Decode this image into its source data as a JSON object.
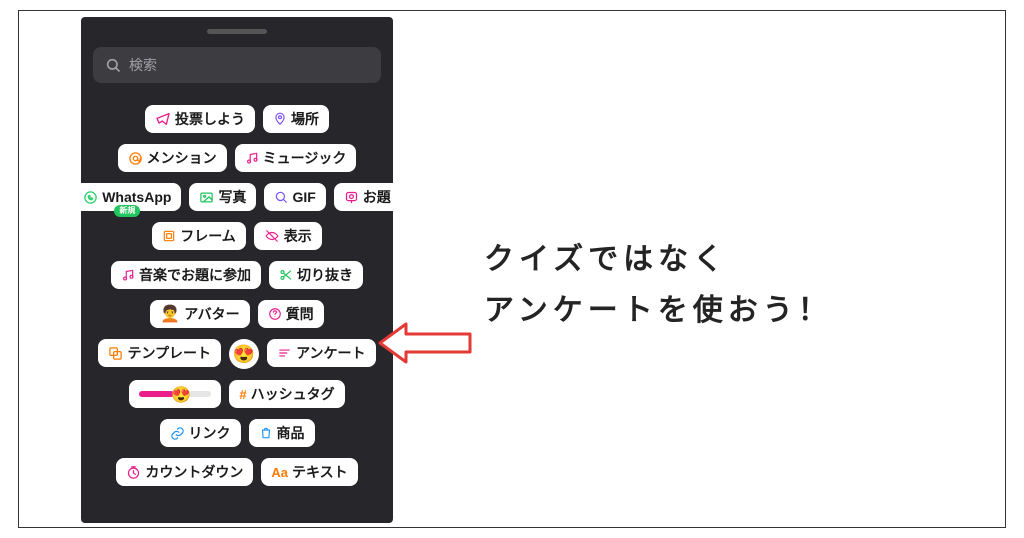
{
  "search": {
    "placeholder": "検索"
  },
  "stickerRows": [
    [
      {
        "id": "vote",
        "label": "投票しよう",
        "iconColor": "#e91e8c"
      },
      {
        "id": "location",
        "label": "場所",
        "iconColor": "#7c4dff"
      }
    ],
    [
      {
        "id": "mention",
        "label": "メンション",
        "iconColor": "#ff7a00"
      },
      {
        "id": "music",
        "label": "ミュージック",
        "iconColor": "#e91e8c"
      }
    ],
    [
      {
        "id": "whatsapp",
        "label": "WhatsApp",
        "iconColor": "#25d366",
        "badge": "新規"
      },
      {
        "id": "photo",
        "label": "写真",
        "iconColor": "#22c55e"
      },
      {
        "id": "gif",
        "label": "GIF",
        "iconColor": "#7c4dff"
      },
      {
        "id": "prompt",
        "label": "お題",
        "iconColor": "#e91e8c"
      }
    ],
    [
      {
        "id": "frame",
        "label": "フレーム",
        "iconColor": "#ff7a00"
      },
      {
        "id": "visibility",
        "label": "表示",
        "iconColor": "#e91e8c"
      }
    ],
    [
      {
        "id": "music-prompt",
        "label": "音楽でお題に参加",
        "iconColor": "#e91e8c"
      },
      {
        "id": "cutout",
        "label": "切り抜き",
        "iconColor": "#22c55e"
      }
    ],
    [
      {
        "id": "avatar",
        "label": "アバター",
        "emoji": "🧑‍🦱"
      },
      {
        "id": "question",
        "label": "質問",
        "iconColor": "#e91e8c"
      }
    ],
    [
      {
        "id": "template",
        "label": "テンプレート",
        "iconColor": "#ff7a00"
      },
      {
        "id": "emoji-reaction",
        "emoji": "😍",
        "round": true
      },
      {
        "id": "poll",
        "label": "アンケート",
        "iconColor": "#e91e8c"
      }
    ],
    [
      {
        "id": "slider",
        "slider": true
      },
      {
        "id": "hashtag",
        "label": "ハッシュタグ",
        "iconColor": "#ff7a00",
        "prefix": "#"
      }
    ],
    [
      {
        "id": "link",
        "label": "リンク",
        "iconColor": "#2196f3"
      },
      {
        "id": "product",
        "label": "商品",
        "iconColor": "#2196f3"
      }
    ],
    [
      {
        "id": "countdown",
        "label": "カウントダウン",
        "iconColor": "#e91e8c"
      },
      {
        "id": "text",
        "label": "テキスト",
        "iconColor": "#ff7a00",
        "prefix": "Aa"
      }
    ]
  ],
  "annotation": {
    "line1": "クイズではなく",
    "line2": "アンケートを使おう！"
  },
  "colors": {
    "arrow": "#e53935"
  }
}
